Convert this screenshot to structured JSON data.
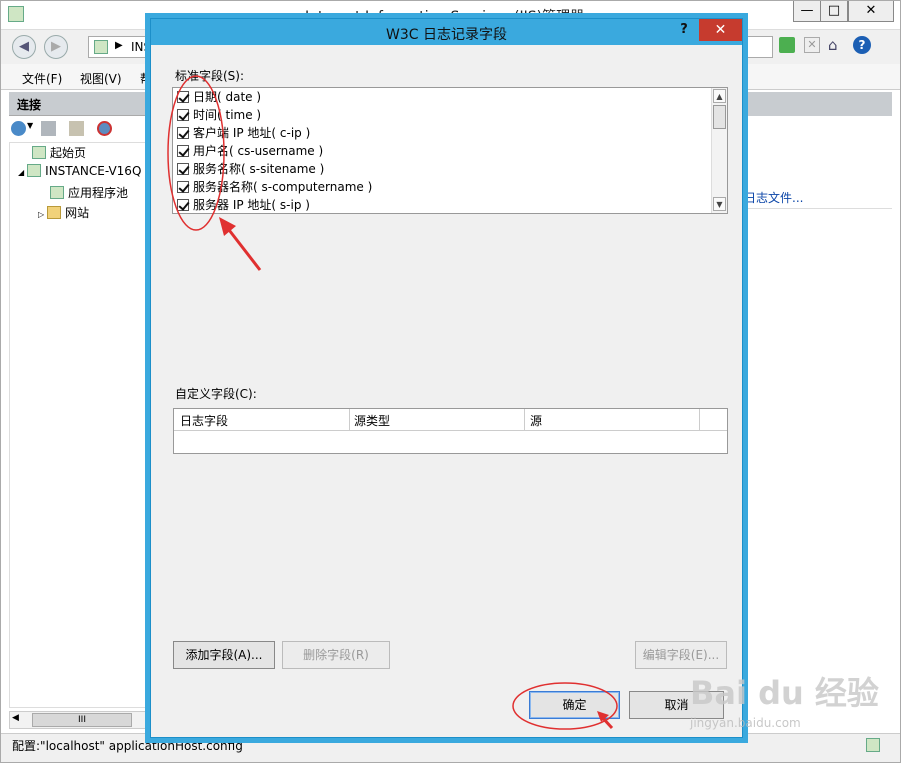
{
  "main_window": {
    "title": "Internet Information Services (IIS)管理器",
    "window_controls": {
      "minimize": "—",
      "maximize": "□",
      "close": "✕"
    },
    "address_text": "INS",
    "menu": [
      "文件(F)",
      "视图(V)",
      "帮"
    ],
    "connections_header": "连接",
    "tree": [
      {
        "label": "起始页",
        "level": 0
      },
      {
        "label": "INSTANCE-V16Q",
        "level": 0,
        "expanded": true
      },
      {
        "label": "应用程序池",
        "level": 1
      },
      {
        "label": "网站",
        "level": 1
      }
    ],
    "right_link": "日志文件...",
    "status_bar": "配置:\"localhost\" applicationHost.config",
    "scroll_glyph": "III"
  },
  "dialog": {
    "title": "W3C 日志记录字段",
    "help_button": "?",
    "close_button": "✕",
    "standard_fields_label": "标准字段(S):",
    "standard_fields": [
      {
        "label": "日期( date )",
        "checked": true
      },
      {
        "label": "时间( time )",
        "checked": true
      },
      {
        "label": "客户端 IP 地址( c-ip )",
        "checked": true
      },
      {
        "label": "用户名( cs-username )",
        "checked": true
      },
      {
        "label": "服务名称( s-sitename )",
        "checked": true
      },
      {
        "label": "服务器名称( s-computername )",
        "checked": true
      },
      {
        "label": "服务器 IP 地址( s-ip )",
        "checked": true
      }
    ],
    "custom_fields_label": "自定义字段(C):",
    "custom_table_headers": [
      "日志字段",
      "源类型",
      "源"
    ],
    "buttons": {
      "add": "添加字段(A)...",
      "delete": "删除字段(R)",
      "edit": "编辑字段(E)...",
      "ok": "确定",
      "cancel": "取消"
    }
  },
  "watermark": {
    "brand": "Bai du 经验",
    "url": "jingyan.baidu.com"
  },
  "colors": {
    "dialog_title": "#3aa9de",
    "close_red": "#c63b2e",
    "annotation_red": "#e03030",
    "link_blue": "#0c46a8"
  }
}
